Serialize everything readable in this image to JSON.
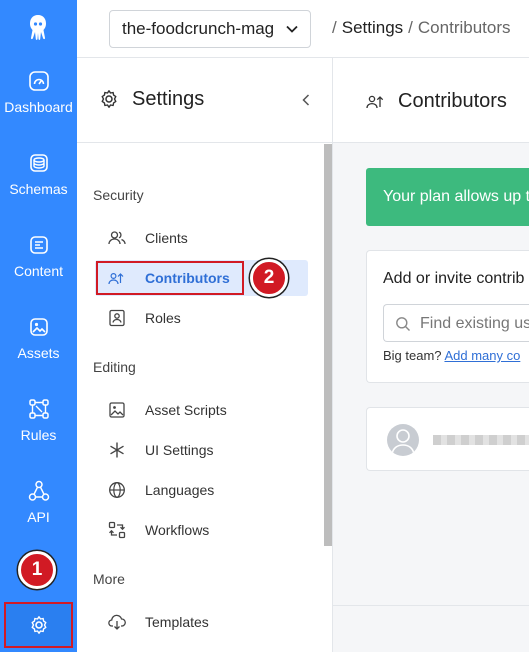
{
  "colors": {
    "rail": "#3389ff",
    "accent": "#2f6fd6",
    "annotation": "#d11a24",
    "plan_banner": "#3dba7e"
  },
  "rail": {
    "logo": "squidex-logo",
    "items": [
      {
        "label": "Dashboard",
        "icon": "gauge-icon"
      },
      {
        "label": "Schemas",
        "icon": "database-icon"
      },
      {
        "label": "Content",
        "icon": "content-icon"
      },
      {
        "label": "Assets",
        "icon": "image-icon"
      },
      {
        "label": "Rules",
        "icon": "rules-icon"
      },
      {
        "label": "API",
        "icon": "api-icon"
      }
    ],
    "settings_icon": "gear-icon"
  },
  "topbar": {
    "app_name": "the-foodcrunch-mag",
    "breadcrumb": {
      "sep1": "/",
      "section": "Settings",
      "sep2": "/",
      "current": "Contributors"
    }
  },
  "settings_panel": {
    "title": "Settings",
    "groups": [
      {
        "label": "Security",
        "items": [
          {
            "label": "Clients",
            "icon": "users-icon"
          },
          {
            "label": "Contributors",
            "icon": "contributors-icon",
            "active": true
          },
          {
            "label": "Roles",
            "icon": "id-card-icon"
          }
        ]
      },
      {
        "label": "Editing",
        "items": [
          {
            "label": "Asset Scripts",
            "icon": "image-icon"
          },
          {
            "label": "UI Settings",
            "icon": "asterisk-icon"
          },
          {
            "label": "Languages",
            "icon": "globe-icon"
          },
          {
            "label": "Workflows",
            "icon": "workflow-icon"
          }
        ]
      },
      {
        "label": "More",
        "items": [
          {
            "label": "Templates",
            "icon": "cloud-download-icon"
          }
        ]
      }
    ]
  },
  "main": {
    "title": "Contributors",
    "plan_banner": "Your plan allows up t",
    "invite": {
      "title": "Add or invite contrib",
      "search_placeholder": "Find existing us",
      "big_team_text": "Big team?",
      "big_team_link": "Add many co"
    }
  },
  "annotations": {
    "step1": "1",
    "step2": "2"
  }
}
